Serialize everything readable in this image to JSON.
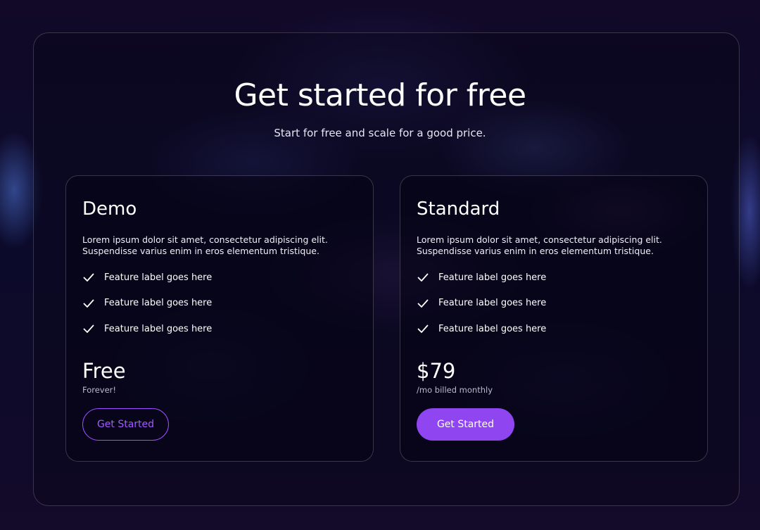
{
  "header": {
    "title": "Get started for free",
    "subtitle": "Start for free and scale for a good price."
  },
  "plans": [
    {
      "name": "Demo",
      "description": "Lorem ipsum dolor sit amet, consectetur adipiscing elit. Suspendisse varius enim in eros elementum tristique.",
      "features": [
        "Feature label goes here",
        "Feature label goes here",
        "Feature label goes here"
      ],
      "price": "Free",
      "price_note": "Forever!",
      "button_label": "Get Started",
      "button_style": "outline"
    },
    {
      "name": "Standard",
      "description": "Lorem ipsum dolor sit amet, consectetur adipiscing elit. Suspendisse varius enim in eros elementum tristique.",
      "features": [
        "Feature label goes here",
        "Feature label goes here",
        "Feature label goes here"
      ],
      "price": "$79",
      "price_note": "/mo billed monthly",
      "button_label": "Get Started",
      "button_style": "filled"
    }
  ],
  "icons": {
    "feature_check": "check-icon"
  },
  "colors": {
    "accent": "#8f45ef",
    "accent_outline": "#9b4dff",
    "text": "#ffffff",
    "muted_text": "#bdb8cc"
  }
}
